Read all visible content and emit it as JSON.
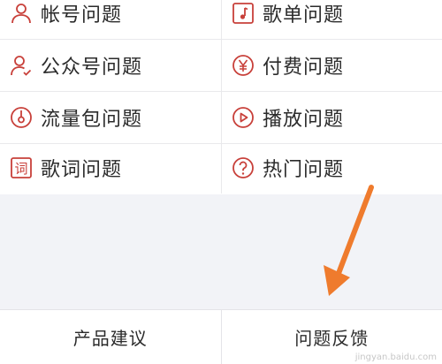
{
  "theme": {
    "accent": "#c8403a",
    "arrow": "#ef7b2d"
  },
  "help_grid": {
    "rows": [
      {
        "left": {
          "label": "帐号问题",
          "icon": "user-icon"
        },
        "right": {
          "label": "歌单问题",
          "icon": "music-note-icon"
        }
      },
      {
        "left": {
          "label": "公众号问题",
          "icon": "user-check-icon"
        },
        "right": {
          "label": "付费问题",
          "icon": "yen-icon"
        }
      },
      {
        "left": {
          "label": "流量包问题",
          "icon": "data-dial-icon"
        },
        "right": {
          "label": "播放问题",
          "icon": "play-circle-icon"
        }
      },
      {
        "left": {
          "label": "歌词问题",
          "icon": "lyrics-icon"
        },
        "right": {
          "label": "热门问题",
          "icon": "question-circle-icon"
        }
      }
    ]
  },
  "bottom_bar": {
    "suggestion_label": "产品建议",
    "feedback_label": "问题反馈"
  },
  "watermark": {
    "text": "jingyan.baidu.com"
  }
}
